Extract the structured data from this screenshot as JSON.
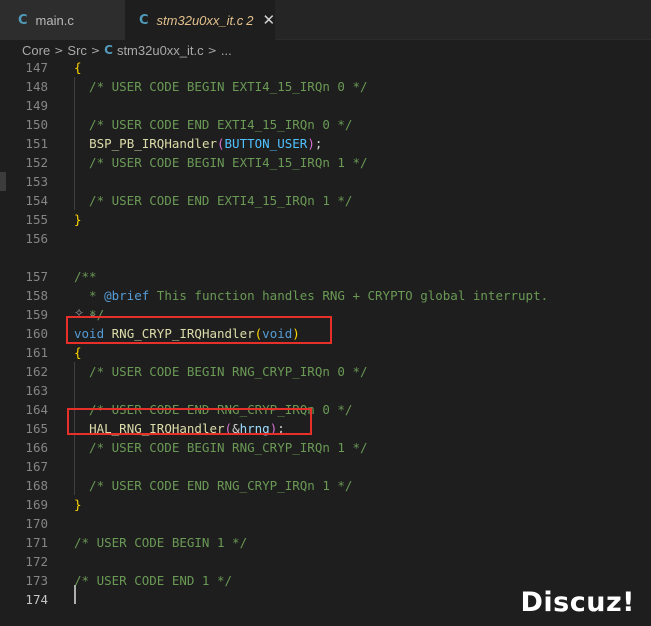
{
  "tabs": [
    {
      "icon": "C",
      "label": "main.c"
    },
    {
      "icon": "C",
      "label": "stm32u0xx_it.c",
      "modified_count": "2",
      "close": "✕"
    }
  ],
  "breadcrumb": {
    "items": [
      "Core",
      "Src"
    ],
    "file_icon": "C",
    "file": "stm32u0xx_it.c",
    "trailing": "..."
  },
  "codelens": {
    "icon": "✧",
    "chevron": "⌄"
  },
  "lines": [
    {
      "n": "147",
      "tokens": [
        {
          "t": "{",
          "c": "brace"
        }
      ]
    },
    {
      "n": "148",
      "tokens": [
        {
          "t": "  /* USER CODE BEGIN EXTI4_15_IRQn 0 */",
          "c": "cmt"
        }
      ]
    },
    {
      "n": "149",
      "tokens": []
    },
    {
      "n": "150",
      "tokens": [
        {
          "t": "  /* USER CODE END EXTI4_15_IRQn 0 */",
          "c": "cmt"
        }
      ]
    },
    {
      "n": "151",
      "tokens": [
        {
          "t": "  "
        },
        {
          "t": "BSP_PB_IRQHandler",
          "c": "fn"
        },
        {
          "t": "(",
          "c": "paren"
        },
        {
          "t": "BUTTON_USER",
          "c": "macro"
        },
        {
          "t": ")",
          "c": "paren"
        },
        {
          "t": ";"
        }
      ]
    },
    {
      "n": "152",
      "tokens": [
        {
          "t": "  /* USER CODE BEGIN EXTI4_15_IRQn 1 */",
          "c": "cmt"
        }
      ]
    },
    {
      "n": "153",
      "tokens": []
    },
    {
      "n": "154",
      "tokens": [
        {
          "t": "  /* USER CODE END EXTI4_15_IRQn 1 */",
          "c": "cmt"
        }
      ]
    },
    {
      "n": "155",
      "tokens": [
        {
          "t": "}",
          "c": "brace"
        }
      ]
    },
    {
      "n": "156",
      "tokens": []
    },
    {
      "n": "157",
      "tokens": [
        {
          "t": "/**",
          "c": "cmt"
        }
      ]
    },
    {
      "n": "158",
      "tokens": [
        {
          "t": "  * ",
          "c": "cmt"
        },
        {
          "t": "@brief",
          "c": "tag"
        },
        {
          "t": " This function handles RNG + CRYPTO global interrupt.",
          "c": "cmt"
        }
      ]
    },
    {
      "n": "159",
      "tokens": [
        {
          "t": "  */",
          "c": "cmt"
        }
      ]
    },
    {
      "n": "160",
      "tokens": [
        {
          "t": "void",
          "c": "kw"
        },
        {
          "t": " "
        },
        {
          "t": "RNG_CRYP_IRQHandler",
          "c": "fn"
        },
        {
          "t": "(",
          "c": "brace"
        },
        {
          "t": "void",
          "c": "kw"
        },
        {
          "t": ")",
          "c": "brace"
        }
      ]
    },
    {
      "n": "161",
      "tokens": [
        {
          "t": "{",
          "c": "brace"
        }
      ]
    },
    {
      "n": "162",
      "tokens": [
        {
          "t": "  /* USER CODE BEGIN RNG_CRYP_IRQn 0 */",
          "c": "cmt"
        }
      ]
    },
    {
      "n": "163",
      "tokens": []
    },
    {
      "n": "164",
      "tokens": [
        {
          "t": "  /* USER CODE END RNG_CRYP_IRQn 0 */",
          "c": "cmt"
        }
      ]
    },
    {
      "n": "165",
      "tokens": [
        {
          "t": "  "
        },
        {
          "t": "HAL_RNG_IRQHandler",
          "c": "fn"
        },
        {
          "t": "(",
          "c": "paren"
        },
        {
          "t": "&"
        },
        {
          "t": "hrng",
          "c": "var"
        },
        {
          "t": ")",
          "c": "paren"
        },
        {
          "t": ";"
        }
      ]
    },
    {
      "n": "166",
      "tokens": [
        {
          "t": "  /* USER CODE BEGIN RNG_CRYP_IRQn 1 */",
          "c": "cmt"
        }
      ]
    },
    {
      "n": "167",
      "tokens": []
    },
    {
      "n": "168",
      "tokens": [
        {
          "t": "  /* USER CODE END RNG_CRYP_IRQn 1 */",
          "c": "cmt"
        }
      ]
    },
    {
      "n": "169",
      "tokens": [
        {
          "t": "}",
          "c": "brace"
        }
      ]
    },
    {
      "n": "170",
      "tokens": []
    },
    {
      "n": "171",
      "tokens": [
        {
          "t": "/* USER CODE BEGIN 1 */",
          "c": "cmt"
        }
      ]
    },
    {
      "n": "172",
      "tokens": []
    },
    {
      "n": "173",
      "tokens": [
        {
          "t": "/* USER CODE END 1 */",
          "c": "cmt"
        }
      ]
    },
    {
      "n": "174",
      "tokens": [],
      "current": true
    }
  ],
  "watermark": "Discuz!",
  "colors": {
    "background": "#1e1e1e",
    "comment": "#6a9955",
    "function": "#dcdcaa",
    "keyword": "#569cd6",
    "highlight_box": "#e8302a"
  }
}
